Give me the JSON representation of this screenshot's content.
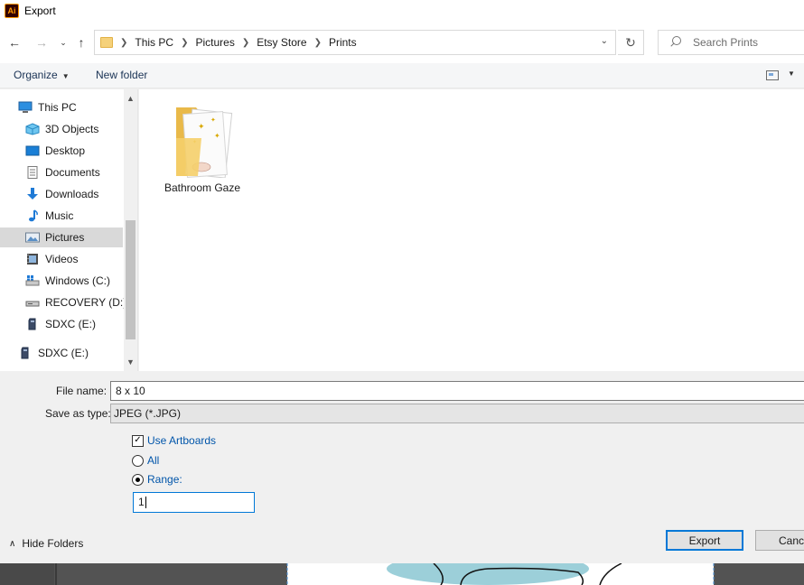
{
  "window": {
    "title": "Export",
    "app_icon_text": "Ai"
  },
  "nav": {
    "breadcrumbs": [
      "This PC",
      "Pictures",
      "Etsy Store",
      "Prints"
    ],
    "search_placeholder": "Search Prints"
  },
  "toolbar": {
    "organize_label": "Organize",
    "new_folder_label": "New folder"
  },
  "sidebar": {
    "items": [
      {
        "label": "This PC",
        "icon": "computer-icon"
      },
      {
        "label": "3D Objects",
        "icon": "cube-icon"
      },
      {
        "label": "Desktop",
        "icon": "desktop-icon"
      },
      {
        "label": "Documents",
        "icon": "document-icon"
      },
      {
        "label": "Downloads",
        "icon": "download-icon"
      },
      {
        "label": "Music",
        "icon": "music-icon"
      },
      {
        "label": "Pictures",
        "icon": "pictures-icon",
        "selected": true
      },
      {
        "label": "Videos",
        "icon": "video-icon"
      },
      {
        "label": "Windows (C:)",
        "icon": "drive-icon"
      },
      {
        "label": "RECOVERY (D:)",
        "icon": "drive-icon"
      },
      {
        "label": "SDXC (E:)",
        "icon": "sd-card-icon"
      },
      {
        "label": "SDXC (E:)",
        "icon": "sd-card-icon"
      }
    ]
  },
  "content": {
    "folders": [
      {
        "name": "Bathroom Gaze"
      }
    ]
  },
  "form": {
    "file_name_label": "File name:",
    "file_name_value": "8 x 10",
    "save_type_label": "Save as type:",
    "save_type_value": "JPEG (*.JPG)",
    "use_artboards_label": "Use Artboards",
    "use_artboards_checked": true,
    "all_label": "All",
    "range_label": "Range:",
    "range_selected": true,
    "range_value": "1"
  },
  "footer": {
    "hide_folders_label": "Hide Folders",
    "export_label": "Export",
    "cancel_label": "Cancel"
  },
  "colors": {
    "accent": "#0078d7",
    "selected_nav": "#d9d9d9",
    "link_blue": "#0055aa"
  }
}
